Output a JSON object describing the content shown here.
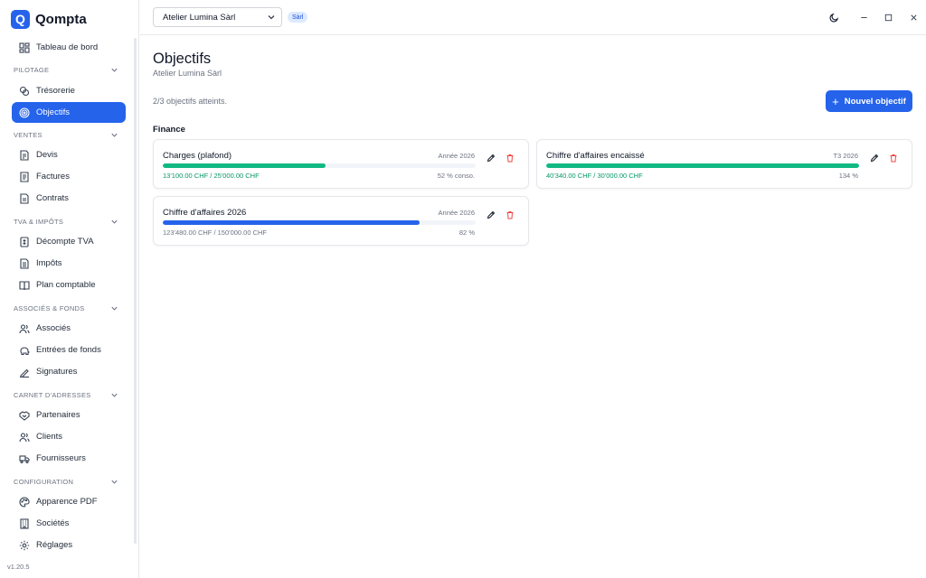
{
  "app": {
    "name": "Qompta",
    "logo_letter": "Q",
    "version": "v1.20.5"
  },
  "sidebar": {
    "top_item": {
      "label": "Tableau de bord",
      "icon": "dashboard-icon"
    },
    "groups": [
      {
        "label": "PILOTAGE",
        "items": [
          {
            "label": "Trésorerie",
            "icon": "coins-icon"
          },
          {
            "label": "Objectifs",
            "icon": "target-icon",
            "active": true
          }
        ]
      },
      {
        "label": "VENTES",
        "items": [
          {
            "label": "Devis",
            "icon": "quote-icon"
          },
          {
            "label": "Factures",
            "icon": "invoice-icon"
          },
          {
            "label": "Contrats",
            "icon": "contract-icon"
          }
        ]
      },
      {
        "label": "TVA & IMPÔTS",
        "items": [
          {
            "label": "Décompte TVA",
            "icon": "vat-icon"
          },
          {
            "label": "Impôts",
            "icon": "tax-icon"
          },
          {
            "label": "Plan comptable",
            "icon": "book-icon"
          }
        ]
      },
      {
        "label": "ASSOCIÉS & FONDS",
        "items": [
          {
            "label": "Associés",
            "icon": "users-icon"
          },
          {
            "label": "Entrées de fonds",
            "icon": "piggy-bank-icon"
          },
          {
            "label": "Signatures",
            "icon": "signature-icon"
          }
        ]
      },
      {
        "label": "CARNET D'ADRESSES",
        "items": [
          {
            "label": "Partenaires",
            "icon": "handshake-icon"
          },
          {
            "label": "Clients",
            "icon": "users-icon"
          },
          {
            "label": "Fournisseurs",
            "icon": "truck-icon"
          }
        ]
      },
      {
        "label": "CONFIGURATION",
        "items": [
          {
            "label": "Apparence PDF",
            "icon": "palette-icon"
          },
          {
            "label": "Sociétés",
            "icon": "building-icon"
          },
          {
            "label": "Réglages",
            "icon": "gear-icon"
          }
        ]
      }
    ]
  },
  "topbar": {
    "company": "Atelier Lumina Sàrl",
    "legal_form": "Sàrl"
  },
  "page": {
    "title": "Objectifs",
    "subtitle": "Atelier Lumina Sàrl",
    "summary": "2/3 objectifs atteints.",
    "new_button": "Nouvel objectif",
    "section": "Finance"
  },
  "objectives": [
    {
      "name": "Charges (plafond)",
      "period": "Année 2026",
      "amounts": "13'100.00 CHF / 25'000.00 CHF",
      "pct_label": "52 % conso.",
      "progress": 0.52,
      "color": "#10b981",
      "amount_color": "#059669"
    },
    {
      "name": "Chiffre d'affaires encaissé",
      "period": "T3 2026",
      "amounts": "40'340.00 CHF / 30'000.00 CHF",
      "pct_label": "134 %",
      "progress": 1.0,
      "color": "#10b981",
      "amount_color": "#059669"
    },
    {
      "name": "Chiffre d'affaires 2026",
      "period": "Année 2026",
      "amounts": "123'480.00 CHF / 150'000.00 CHF",
      "pct_label": "82 %",
      "progress": 0.82,
      "color": "#2563eb",
      "amount_color": "#6b7280"
    }
  ],
  "colors": {
    "accent": "#2563eb",
    "success": "#10b981",
    "danger": "#ef4444"
  }
}
